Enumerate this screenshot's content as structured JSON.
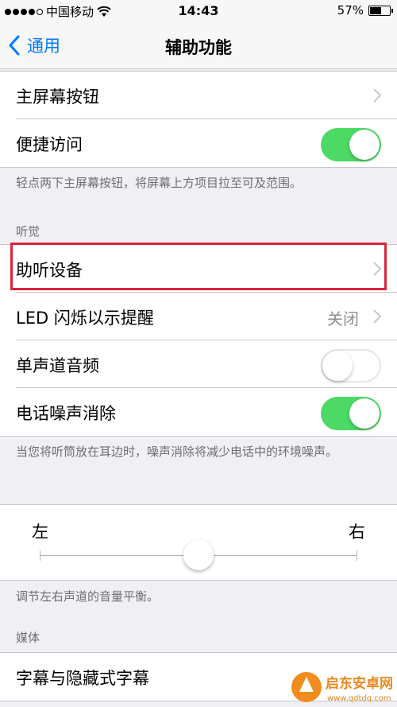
{
  "status_bar": {
    "carrier": "中国移动",
    "time": "14:43",
    "battery": "57%",
    "battery_level": 0.57
  },
  "nav": {
    "back_label": "通用",
    "title": "辅助功能"
  },
  "group1": {
    "home_button": "主屏幕按钮",
    "reachability": "便捷访问",
    "reachability_on": true,
    "footer": "轻点两下主屏幕按钮，将屏幕上方项目拉至可及范围。"
  },
  "hearing": {
    "header": "听觉",
    "hearing_devices": "助听设备",
    "led_flash": "LED 闪烁以示提醒",
    "led_flash_value": "关闭",
    "mono_audio": "单声道音频",
    "mono_audio_on": false,
    "noise_cancel": "电话噪声消除",
    "noise_cancel_on": true,
    "footer": "当您将听筒放在耳边时，噪声消除将减少电话中的环境噪声。"
  },
  "balance": {
    "left": "左",
    "right": "右",
    "value": 0.5,
    "footer": "调节左右声道的音量平衡。"
  },
  "media": {
    "header": "媒体",
    "subtitles": "字幕与隐藏式字幕"
  },
  "watermark": {
    "text": "启东安卓网",
    "url": "www.qdtdq.com"
  },
  "colors": {
    "accent": "#007aff",
    "toggle_on": "#4cd964",
    "highlight": "#d7263d"
  }
}
